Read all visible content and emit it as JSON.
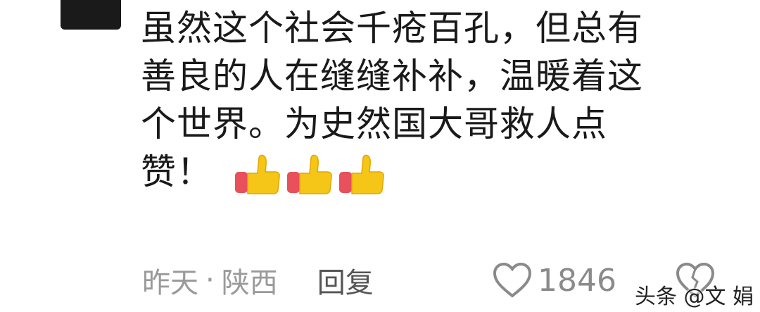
{
  "comment": {
    "lines": [
      "虽然这个社会千疮百孔，但总有",
      "善良的人在缝缝补补，温暖着这",
      "个世界。为史然国大哥救人点",
      "赞！"
    ],
    "emoji": [
      "thumbs-up-icon",
      "thumbs-up-icon",
      "thumbs-up-icon"
    ]
  },
  "meta": {
    "time": "昨天",
    "separator": "·",
    "location": "陕西",
    "reply_label": "回复"
  },
  "likes": {
    "count": "1846"
  },
  "watermark": "头条 @文 娟",
  "colors": {
    "text": "#1a1a1a",
    "meta": "#9a9a9a",
    "thumb": "#f5c518",
    "cuff": "#e8505b"
  }
}
